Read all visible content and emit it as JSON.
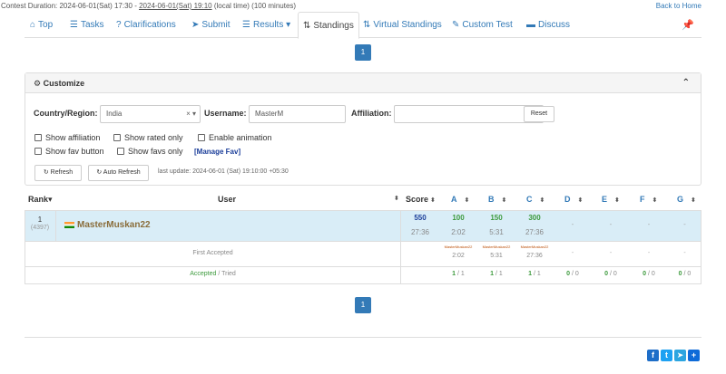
{
  "contest": {
    "duration_prefix": "Contest Duration: 2024-06-01(Sat) 17:30 - ",
    "duration_end": "2024-06-01(Sat) 19:10",
    "duration_suffix": " (local time) (100 minutes)",
    "back_link": "Back to Home"
  },
  "tabs": [
    {
      "label": "Top",
      "icon": "home-icon"
    },
    {
      "label": "Tasks",
      "icon": "list-icon"
    },
    {
      "label": "Clarifications",
      "icon": "question-icon"
    },
    {
      "label": "Submit",
      "icon": "send-icon"
    },
    {
      "label": "Results",
      "icon": "list-icon"
    },
    {
      "label": "Standings",
      "icon": "sort-icon"
    },
    {
      "label": "Virtual Standings",
      "icon": "sort-icon"
    },
    {
      "label": "Custom Test",
      "icon": "wrench-icon"
    },
    {
      "label": "Discuss",
      "icon": "comment-icon"
    }
  ],
  "pager": {
    "page": "1"
  },
  "customize": {
    "title": "Customize",
    "country_label": "Country/Region:",
    "country_value": "India",
    "username_label": "Username:",
    "username_value": "MasterM",
    "affiliation_label": "Affiliation:",
    "affiliation_value": "",
    "reset": "Reset",
    "opt_affiliation": "Show affiliation",
    "opt_rated": "Show rated only",
    "opt_animation": "Enable animation",
    "opt_favbutton": "Show fav button",
    "opt_favsonly": "Show favs only",
    "manage_fav": "[Manage Fav]",
    "refresh": "Refresh",
    "auto_refresh": "Auto Refresh",
    "last_update": "last update: 2024-06-01 (Sat) 19:10:00 +05:30"
  },
  "table": {
    "headers": {
      "rank": "Rank",
      "user": "User",
      "score": "Score",
      "problems": [
        "A",
        "B",
        "C",
        "D",
        "E",
        "F",
        "G"
      ]
    },
    "row": {
      "rank": "1",
      "rank_sub": "(4397)",
      "user": "MasterMuskan22",
      "score": "550",
      "score_time": "27:36",
      "problems": [
        {
          "score": "100",
          "time": "2:02"
        },
        {
          "score": "150",
          "time": "5:31"
        },
        {
          "score": "300",
          "time": "27:36"
        },
        {
          "score": "-",
          "time": ""
        },
        {
          "score": "-",
          "time": ""
        },
        {
          "score": "-",
          "time": ""
        },
        {
          "score": "-",
          "time": ""
        }
      ]
    },
    "first_accepted": {
      "label": "First Accepted",
      "entries": [
        {
          "user": "MasterMuskan22",
          "time": "2:02"
        },
        {
          "user": "MasterMuskan22",
          "time": "5:31"
        },
        {
          "user": "MasterMuskan22",
          "time": "27:36"
        },
        {
          "user": "-",
          "time": ""
        },
        {
          "user": "-",
          "time": ""
        },
        {
          "user": "-",
          "time": ""
        },
        {
          "user": "-",
          "time": ""
        }
      ]
    },
    "accepted_tried": {
      "label_accepted": "Accepted",
      "label_tried": " / Tried",
      "entries": [
        {
          "a": "1",
          "t": "1"
        },
        {
          "a": "1",
          "t": "1"
        },
        {
          "a": "1",
          "t": "1"
        },
        {
          "a": "0",
          "t": "0"
        },
        {
          "a": "0",
          "t": "0"
        },
        {
          "a": "0",
          "t": "0"
        },
        {
          "a": "0",
          "t": "0"
        }
      ]
    }
  },
  "colors": {
    "link": "#337ab7",
    "accepted": "#3c9a3c",
    "score": "#1a3d99",
    "highlight": "#d9edf7"
  }
}
